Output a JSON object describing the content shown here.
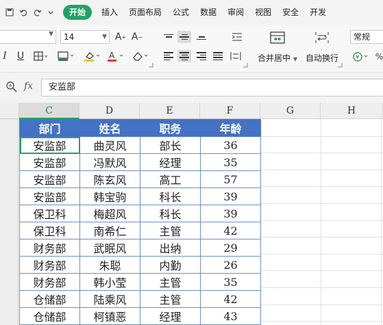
{
  "quick_access": {
    "undo_icon": "undo-icon",
    "redo_icon": "redo-icon",
    "more_icon": "chevron-down-icon"
  },
  "menu": {
    "tabs": [
      "开始",
      "插入",
      "页面布局",
      "公式",
      "数据",
      "审阅",
      "视图",
      "安全",
      "开发"
    ],
    "active_tab": "开始",
    "active_color": "#21a366"
  },
  "ribbon": {
    "font_size": "14",
    "number_format": "常规",
    "merge_label": "合并居中",
    "wrap_label": "自动换行",
    "icons": [
      "grow-font-icon",
      "shrink-font-icon",
      "italic-icon",
      "underline-icon",
      "border-icon",
      "fill-color-icon",
      "font-color-icon",
      "eraser-icon",
      "align-top-icon",
      "align-middle-icon",
      "align-bottom-icon",
      "indent-icon",
      "align-left-icon",
      "align-center-icon",
      "align-right-icon",
      "justify-icon",
      "distribute-icon",
      "merge-center-icon",
      "wrap-text-icon",
      "currency-icon"
    ]
  },
  "formula_bar": {
    "fx_label": "fx",
    "value": "安监部"
  },
  "grid": {
    "columns": [
      "C",
      "D",
      "E",
      "F",
      "G",
      "H"
    ],
    "active_column": "C",
    "header_fill": "#4472c4",
    "table": {
      "headers": [
        "部门",
        "姓名",
        "职务",
        "年龄"
      ],
      "rows": [
        [
          "安监部",
          "曲灵风",
          "部长",
          "36"
        ],
        [
          "安监部",
          "冯默风",
          "经理",
          "35"
        ],
        [
          "安监部",
          "陈玄风",
          "高工",
          "57"
        ],
        [
          "安监部",
          "韩宝驹",
          "科长",
          "39"
        ],
        [
          "保卫科",
          "梅超风",
          "科长",
          "39"
        ],
        [
          "保卫科",
          "南希仁",
          "主管",
          "42"
        ],
        [
          "财务部",
          "武眠风",
          "出纳",
          "29"
        ],
        [
          "财务部",
          "朱聪",
          "内勤",
          "26"
        ],
        [
          "财务部",
          "韩小莹",
          "主管",
          "35"
        ],
        [
          "仓储部",
          "陆乘风",
          "主管",
          "42"
        ],
        [
          "仓储部",
          "柯镇恶",
          "经理",
          "43"
        ]
      ]
    }
  }
}
